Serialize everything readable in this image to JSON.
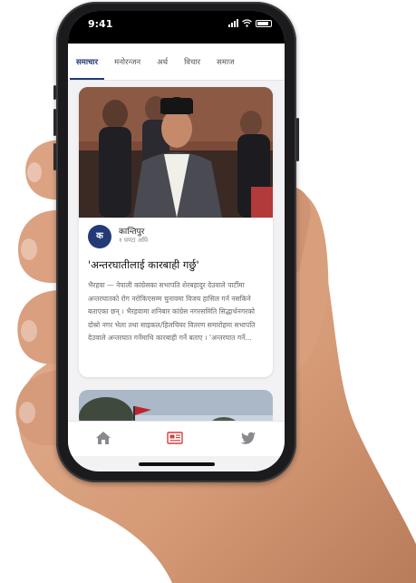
{
  "status_bar": {
    "time": "9:41"
  },
  "tabs": [
    {
      "label": "समाचार",
      "active": true
    },
    {
      "label": "मनोरन्जन",
      "active": false
    },
    {
      "label": "अर्थ",
      "active": false
    },
    {
      "label": "विचार",
      "active": false
    },
    {
      "label": "समाज",
      "active": false
    }
  ],
  "article": {
    "source_name": "कान्तिपुर",
    "source_logo_text": "क",
    "time_ago": "१ घण्टा अघि",
    "headline": "'अन्तरघातीलाई कारबाही गर्छु'",
    "summary": "भैरहवा — नेपाली कांग्रेसका सभापति शेरबहादुर देउवाले पार्टीमा अन्तरघातको रोग नरोकिएसम्म चुनावमा विजय हासिल गर्न नसकिने बताएका छन् । भैरहवामा शनिबार कांग्रेस नगरसमिति सिद्धार्थनगरको दोस्रो नगर भेला तथा साइकल/हिलचियर वितरण समारोहमा सभापति देउवाले अन्तरघात गर्नेमाथि कारबाही गर्ने बताए । 'अन्तरघात गर्ने..."
  },
  "bottom_nav": {
    "home_icon": "home-icon",
    "news_icon": "newspaper-icon",
    "twitter_icon": "twitter-icon"
  },
  "colors": {
    "accent": "#233a76",
    "skin": "#d69c7a"
  }
}
